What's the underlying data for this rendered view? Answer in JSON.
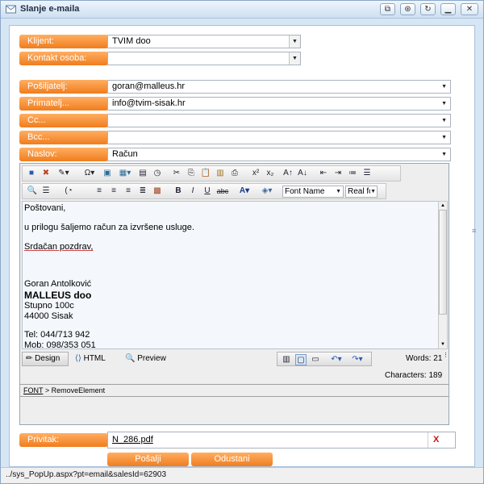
{
  "window": {
    "title": "Slanje e-maila"
  },
  "titlebar_buttons": [
    "restore-icon",
    "pin-icon",
    "refresh-icon",
    "minimize-icon",
    "maximize-icon",
    "close-icon"
  ],
  "form": {
    "client": {
      "label": "Klijent:",
      "value": "TVIM doo"
    },
    "contact": {
      "label": "Kontakt osoba:",
      "value": ""
    },
    "sender": {
      "label": "Pošiljatelj:",
      "value": "goran@malleus.hr"
    },
    "recipient": {
      "label": "Primatelj...",
      "value": "info@tvim-sisak.hr"
    },
    "cc": {
      "label": "Cc...",
      "value": ""
    },
    "bcc": {
      "label": "Bcc...",
      "value": ""
    },
    "subject": {
      "label": "Naslov:",
      "value": "Račun"
    }
  },
  "editor": {
    "font_name": "Font Name",
    "font_size": "Real fc",
    "body_lines": [
      "Poštovani,",
      "u prilogu šaljemo račun za izvršene usluge.",
      "Srdačan pozdrav,",
      "Goran Antolković",
      "MALLEUS doo",
      "Stupno 100c",
      "44000 Sisak",
      "Tel: 044/713 942",
      "Mob: 098/353 051"
    ],
    "modes": {
      "design": "Design",
      "html": "HTML",
      "preview": "Preview"
    },
    "words": "Words: 21",
    "characters": "Characters: 189",
    "path": {
      "font": "FONT",
      "separator": " > ",
      "element": "RemoveElement"
    }
  },
  "attachment": {
    "label": "Privitak:",
    "file": "N_286.pdf",
    "remove": "X"
  },
  "actions": {
    "send": "Pošalji",
    "cancel": "Odustani"
  },
  "statusbar": {
    "url": "../sys_PopUp.aspx?pt=email&salesId=62903"
  },
  "colors": {
    "accent": "#f07d1e",
    "title_bg": "#d6e6f5",
    "remove": "#d01010"
  }
}
